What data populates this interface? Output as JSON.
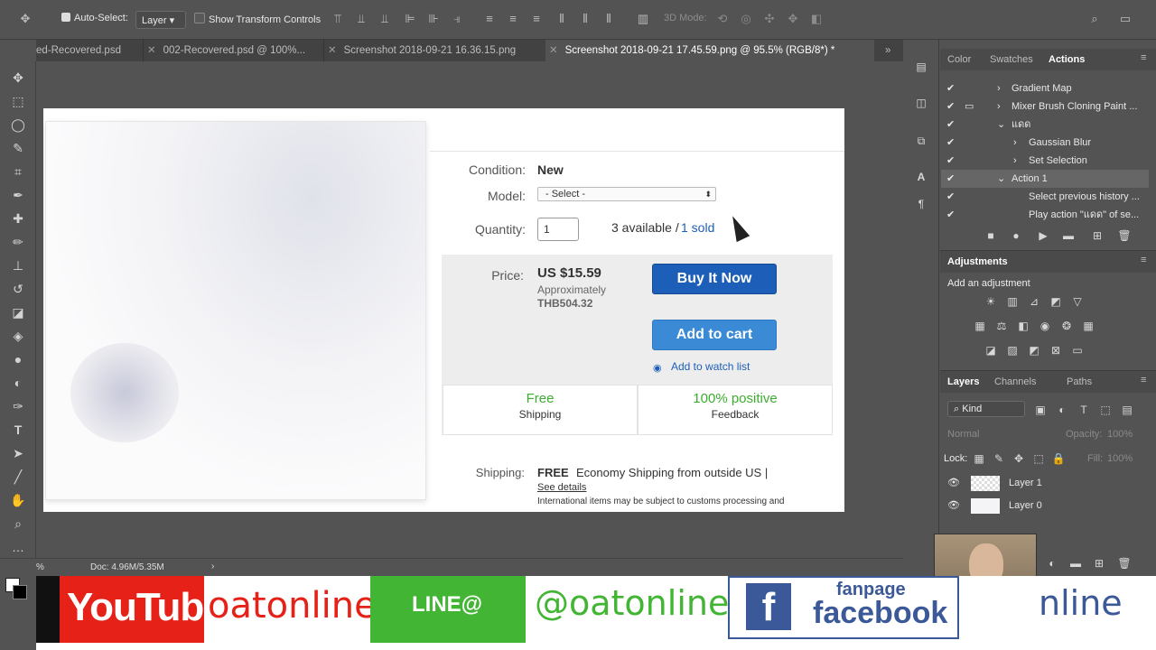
{
  "options_bar": {
    "auto_select_label": "Auto-Select:",
    "auto_select_target": "Layer",
    "show_transform_label": "Show Transform Controls",
    "mode_3d_label": "3D Mode:"
  },
  "tabs": [
    {
      "label": "ed-Recovered.psd"
    },
    {
      "label": "002-Recovered.psd @ 100%..."
    },
    {
      "label": "Screenshot 2018-09-21 16.36.15.png"
    },
    {
      "label": "Screenshot 2018-09-21 17.45.59.png @ 95.5% (RGB/8*) *"
    }
  ],
  "listing": {
    "condition_label": "Condition:",
    "condition_value": "New",
    "model_label": "Model:",
    "model_placeholder": "- Select -",
    "quantity_label": "Quantity:",
    "quantity_value": "1",
    "available_text": "3 available /",
    "sold_link": "1 sold",
    "price_label": "Price:",
    "price_value": "US $15.59",
    "approx_label": "Approximately",
    "approx_value": "THB504.32",
    "buy_now_label": "Buy It Now",
    "add_cart_label": "Add to cart",
    "watch_label": "Add to watch list",
    "free_title": "Free",
    "free_sub": "Shipping",
    "positive_title": "100% positive",
    "positive_sub": "Feedback",
    "shipping_label": "Shipping:",
    "shipping_free": "FREE",
    "shipping_text": "Economy Shipping from outside US |",
    "see_details": "See details",
    "intl_text": "International items may be subject to customs processing and"
  },
  "panels": {
    "top_tabs": [
      "Color",
      "Swatches",
      "Actions"
    ],
    "actions": [
      {
        "label": "Gradient Map",
        "indent": 1
      },
      {
        "label": "Mixer Brush Cloning Paint ...",
        "indent": 1
      },
      {
        "label": "แดด",
        "indent": 1
      },
      {
        "label": "Gaussian Blur",
        "indent": 2
      },
      {
        "label": "Set Selection",
        "indent": 2
      },
      {
        "label": "Action 1",
        "indent": 1
      },
      {
        "label": "Select previous history ...",
        "indent": 2
      },
      {
        "label": "Play action \"แดด\" of se...",
        "indent": 2
      }
    ],
    "adjustments_title": "Adjustments",
    "add_adjustment": "Add an adjustment",
    "layer_tabs": [
      "Layers",
      "Channels",
      "Paths"
    ],
    "kind_label": "Kind",
    "blend_mode": "Normal",
    "opacity_label": "Opacity:",
    "opacity_value": "100%",
    "lock_label": "Lock:",
    "fill_label": "Fill:",
    "fill_value": "100%",
    "layers": [
      "Layer 1",
      "Layer 0"
    ]
  },
  "status": {
    "zoom": "%",
    "doc": "Doc: 4.96M/5.35M"
  },
  "banner": {
    "youtube": "YouTube",
    "youtube_handle": "oatonline",
    "line": "LINE@",
    "line_handle": "@oatonline",
    "fanpage": "fanpage",
    "facebook": "facebook",
    "tail": "nline"
  },
  "colors": {
    "ebay_blue": "#1d5fb8",
    "ebay_light_blue": "#3a8ad6",
    "green": "#3cae2f",
    "youtube_red": "#e62117",
    "line_green": "#43b534",
    "fb_blue": "#3b5998"
  }
}
